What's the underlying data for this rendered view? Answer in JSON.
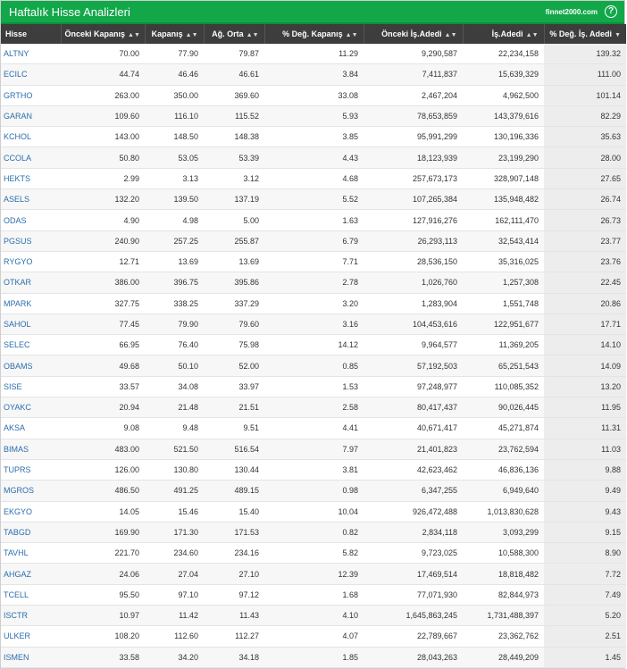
{
  "header": {
    "title": "Haftalık Hisse Analizleri",
    "brand": "finnet2000.com",
    "help_label": "?"
  },
  "columns": [
    "Hisse",
    "Önceki Kapanış",
    "Kapanış",
    "Ağ. Orta",
    "% Değ. Kapanış",
    "Önceki İş.Adedi",
    "İş.Adedi",
    "% Değ. İş. Adedi"
  ],
  "sort_icon": "▲▼",
  "sort_desc_icon": "▼",
  "rows": [
    [
      "ALTNY",
      "70.00",
      "77.90",
      "79.87",
      "11.29",
      "9,290,587",
      "22,234,158",
      "139.32"
    ],
    [
      "ECILC",
      "44.74",
      "46.46",
      "46.61",
      "3.84",
      "7,411,837",
      "15,639,329",
      "111.00"
    ],
    [
      "GRTHO",
      "263.00",
      "350.00",
      "369.60",
      "33.08",
      "2,467,204",
      "4,962,500",
      "101.14"
    ],
    [
      "GARAN",
      "109.60",
      "116.10",
      "115.52",
      "5.93",
      "78,653,859",
      "143,379,616",
      "82.29"
    ],
    [
      "KCHOL",
      "143.00",
      "148.50",
      "148.38",
      "3.85",
      "95,991,299",
      "130,196,336",
      "35.63"
    ],
    [
      "CCOLA",
      "50.80",
      "53.05",
      "53.39",
      "4.43",
      "18,123,939",
      "23,199,290",
      "28.00"
    ],
    [
      "HEKTS",
      "2.99",
      "3.13",
      "3.12",
      "4.68",
      "257,673,173",
      "328,907,148",
      "27.65"
    ],
    [
      "ASELS",
      "132.20",
      "139.50",
      "137.19",
      "5.52",
      "107,265,384",
      "135,948,482",
      "26.74"
    ],
    [
      "ODAS",
      "4.90",
      "4.98",
      "5.00",
      "1.63",
      "127,916,276",
      "162,111,470",
      "26.73"
    ],
    [
      "PGSUS",
      "240.90",
      "257.25",
      "255.87",
      "6.79",
      "26,293,113",
      "32,543,414",
      "23.77"
    ],
    [
      "RYGYO",
      "12.71",
      "13.69",
      "13.69",
      "7.71",
      "28,536,150",
      "35,316,025",
      "23.76"
    ],
    [
      "OTKAR",
      "386.00",
      "396.75",
      "395.86",
      "2.78",
      "1,026,760",
      "1,257,308",
      "22.45"
    ],
    [
      "MPARK",
      "327.75",
      "338.25",
      "337.29",
      "3.20",
      "1,283,904",
      "1,551,748",
      "20.86"
    ],
    [
      "SAHOL",
      "77.45",
      "79.90",
      "79.60",
      "3.16",
      "104,453,616",
      "122,951,677",
      "17.71"
    ],
    [
      "SELEC",
      "66.95",
      "76.40",
      "75.98",
      "14.12",
      "9,964,577",
      "11,369,205",
      "14.10"
    ],
    [
      "OBAMS",
      "49.68",
      "50.10",
      "52.00",
      "0.85",
      "57,192,503",
      "65,251,543",
      "14.09"
    ],
    [
      "SISE",
      "33.57",
      "34.08",
      "33.97",
      "1.53",
      "97,248,977",
      "110,085,352",
      "13.20"
    ],
    [
      "OYAKC",
      "20.94",
      "21.48",
      "21.51",
      "2.58",
      "80,417,437",
      "90,026,445",
      "11.95"
    ],
    [
      "AKSA",
      "9.08",
      "9.48",
      "9.51",
      "4.41",
      "40,671,417",
      "45,271,874",
      "11.31"
    ],
    [
      "BIMAS",
      "483.00",
      "521.50",
      "516.54",
      "7.97",
      "21,401,823",
      "23,762,594",
      "11.03"
    ],
    [
      "TUPRS",
      "126.00",
      "130.80",
      "130.44",
      "3.81",
      "42,623,462",
      "46,836,136",
      "9.88"
    ],
    [
      "MGROS",
      "486.50",
      "491.25",
      "489.15",
      "0.98",
      "6,347,255",
      "6,949,640",
      "9.49"
    ],
    [
      "EKGYO",
      "14.05",
      "15.46",
      "15.40",
      "10.04",
      "926,472,488",
      "1,013,830,628",
      "9.43"
    ],
    [
      "TABGD",
      "169.90",
      "171.30",
      "171.53",
      "0.82",
      "2,834,118",
      "3,093,299",
      "9.15"
    ],
    [
      "TAVHL",
      "221.70",
      "234.60",
      "234.16",
      "5.82",
      "9,723,025",
      "10,588,300",
      "8.90"
    ],
    [
      "AHGAZ",
      "24.06",
      "27.04",
      "27.10",
      "12.39",
      "17,469,514",
      "18,818,482",
      "7.72"
    ],
    [
      "TCELL",
      "95.50",
      "97.10",
      "97.12",
      "1.68",
      "77,071,930",
      "82,844,973",
      "7.49"
    ],
    [
      "ISCTR",
      "10.97",
      "11.42",
      "11.43",
      "4.10",
      "1,645,863,245",
      "1,731,488,397",
      "5.20"
    ],
    [
      "ULKER",
      "108.20",
      "112.60",
      "112.27",
      "4.07",
      "22,789,667",
      "23,362,762",
      "2.51"
    ],
    [
      "ISMEN",
      "33.58",
      "34.20",
      "34.18",
      "1.85",
      "28,043,263",
      "28,449,209",
      "1.45"
    ]
  ]
}
